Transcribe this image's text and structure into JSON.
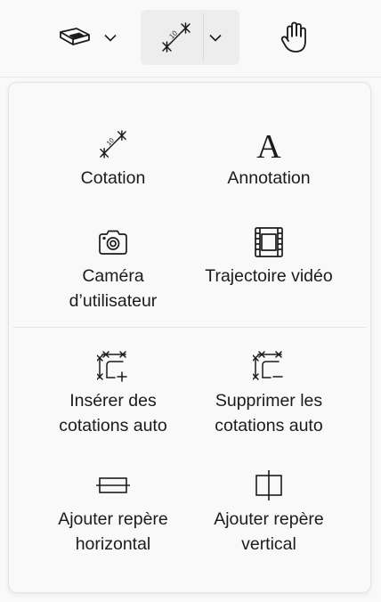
{
  "toolbar": {
    "view_3d_button": {
      "icon": "3d-view-icon",
      "dropdown_icon": "chevron-down-icon"
    },
    "measure_button": {
      "icon": "measure-icon",
      "dropdown_icon": "chevron-down-icon",
      "selected": true
    },
    "pan_button": {
      "icon": "hand-icon"
    }
  },
  "menu": {
    "items": [
      {
        "label": "Cotation",
        "icon": "dimension-icon"
      },
      {
        "label": "Annotation",
        "icon": "annotation-icon"
      },
      {
        "label": "Caméra\nd’utilisateur",
        "icon": "camera-icon"
      },
      {
        "label": "Trajectoire vidéo",
        "icon": "video-trajectory-icon"
      },
      {
        "label": "Insérer des\ncotations auto",
        "icon": "insert-auto-dimensions-icon"
      },
      {
        "label": "Supprimer les\ncotations auto",
        "icon": "remove-auto-dimensions-icon"
      },
      {
        "label": "Ajouter repère\nhorizontal",
        "icon": "horizontal-guide-icon"
      },
      {
        "label": "Ajouter repère\nvertical",
        "icon": "vertical-guide-icon"
      }
    ]
  },
  "colors": {
    "background": "#f9f9f9",
    "selected_button": "#ededed",
    "text": "#1b1b1b",
    "separator": "#e3e3e3"
  }
}
